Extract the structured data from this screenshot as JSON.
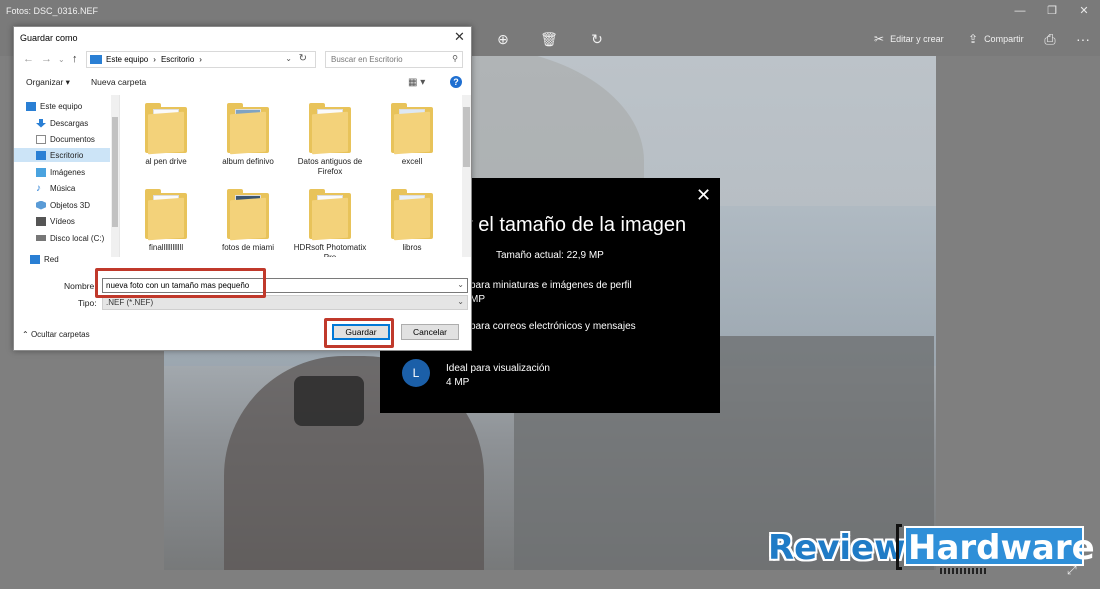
{
  "app": {
    "title": "Fotos: DSC_0316.NEF",
    "toolbar": {
      "edit_label": "Editar y crear",
      "share_label": "Compartir",
      "more": "···"
    }
  },
  "resize_dialog": {
    "close": "✕",
    "title": "r el tamaño de la imagen",
    "current_size": "Tamaño actual: 22,9 MP",
    "options": [
      {
        "line1": "para miniaturas e imágenes de perfil",
        "line2": "MP"
      },
      {
        "line1": "para correos electrónicos y mensajes"
      },
      {
        "badge": "L",
        "title": "Ideal para visualización",
        "size": "4 MP"
      }
    ]
  },
  "save_dialog": {
    "title": "Guardar como",
    "close": "✕",
    "address": [
      "Este equipo",
      "›",
      "Escritorio",
      "›"
    ],
    "search_placeholder": "Buscar en Escritorio",
    "organize_label": "Organizar ▾",
    "new_folder_label": "Nueva carpeta",
    "help": "?",
    "nav_items": [
      {
        "label": "Este equipo",
        "icon": "pc-icon",
        "color": "#2a7fd4"
      },
      {
        "label": "Descargas",
        "icon": "download-icon",
        "color": "#2a7fd4"
      },
      {
        "label": "Documentos",
        "icon": "documents-icon",
        "color": "#8a8a8a"
      },
      {
        "label": "Escritorio",
        "icon": "desktop-icon",
        "color": "#2a7fd4",
        "selected": true
      },
      {
        "label": "Imágenes",
        "icon": "pictures-icon",
        "color": "#4aa3df"
      },
      {
        "label": "Música",
        "icon": "music-icon",
        "color": "#2a7fd4"
      },
      {
        "label": "Objetos 3D",
        "icon": "3d-objects-icon",
        "color": "#5a9bd6"
      },
      {
        "label": "Vídeos",
        "icon": "videos-icon",
        "color": "#555555"
      },
      {
        "label": "Disco local (C:)",
        "icon": "drive-icon",
        "color": "#777777"
      },
      {
        "label": "Red",
        "icon": "network-icon",
        "color": "#2a7fd4"
      }
    ],
    "files": [
      {
        "name": "al pen drive"
      },
      {
        "name": "album definivo"
      },
      {
        "name": "Datos antiguos de Firefox"
      },
      {
        "name": "excell"
      },
      {
        "name": "finallllllllllll"
      },
      {
        "name": "fotos de miami"
      },
      {
        "name": "HDRsoft Photomatix Pro"
      },
      {
        "name": "libros"
      }
    ],
    "filename_label": "Nombre",
    "filename_value": "nueva foto con un tamaño mas pequeño",
    "type_label": "Tipo:",
    "type_value": ".NEF (*.NEF)",
    "hide_folders_label": "Ocultar carpetas",
    "save_label": "Guardar",
    "cancel_label": "Cancelar",
    "highlight_color": "#c0392b"
  },
  "watermark": {
    "word1": "Review",
    "word2": "Hardware"
  }
}
